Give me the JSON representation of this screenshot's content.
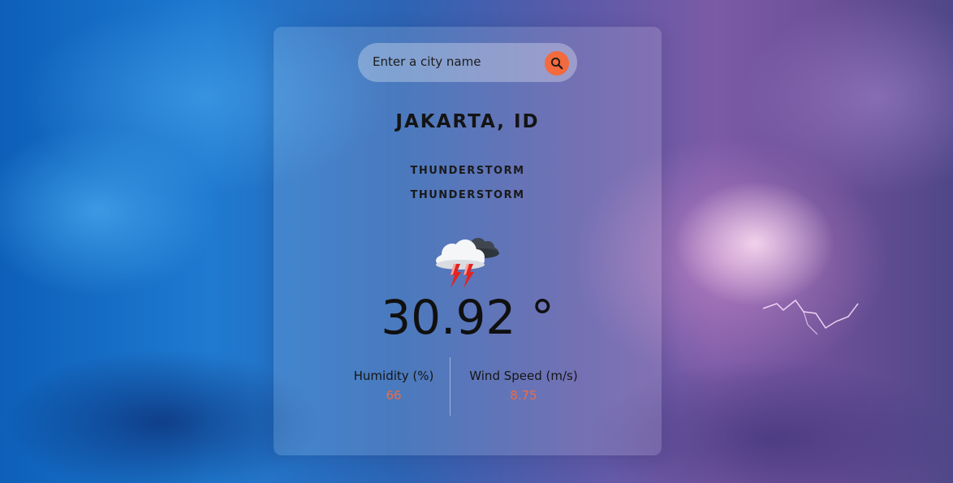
{
  "search": {
    "placeholder": "Enter a city name",
    "value": ""
  },
  "location": {
    "city": "JAKARTA, ID"
  },
  "weather": {
    "main": "THUNDERSTORM",
    "description": "THUNDERSTORM",
    "icon": "thunderstorm-cloud-icon",
    "temperature": "30.92 °"
  },
  "stats": {
    "humidity": {
      "label": "Humidity (%)",
      "value": "66"
    },
    "wind": {
      "label": "Wind Speed (m/s)",
      "value": "8.75"
    }
  },
  "colors": {
    "accent": "#f26a3d",
    "text": "#141414"
  }
}
